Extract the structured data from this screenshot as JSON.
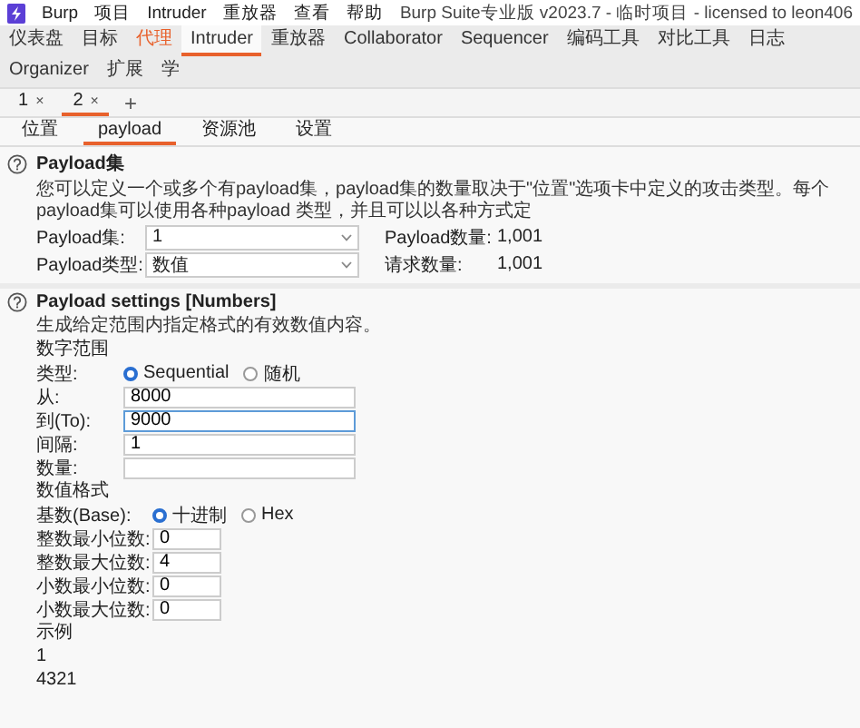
{
  "menu_bar": {
    "items": [
      "Burp",
      "项目",
      "Intruder",
      "重放器",
      "查看",
      "帮助"
    ],
    "title": "Burp Suite专业版 v2023.7 - 临时项目 - licensed to leon406"
  },
  "main_tabs": [
    {
      "label": "仪表盘",
      "selected": false,
      "highlighted": false
    },
    {
      "label": "目标",
      "selected": false,
      "highlighted": false
    },
    {
      "label": "代理",
      "selected": false,
      "highlighted": true
    },
    {
      "label": "Intruder",
      "selected": true,
      "highlighted": false
    },
    {
      "label": "重放器",
      "selected": false,
      "highlighted": false
    },
    {
      "label": "Collaborator",
      "selected": false,
      "highlighted": false
    },
    {
      "label": "Sequencer",
      "selected": false,
      "highlighted": false
    },
    {
      "label": "编码工具",
      "selected": false,
      "highlighted": false
    },
    {
      "label": "对比工具",
      "selected": false,
      "highlighted": false
    },
    {
      "label": "日志",
      "selected": false,
      "highlighted": false
    },
    {
      "label": "Organizer",
      "selected": false,
      "highlighted": false
    },
    {
      "label": "扩展",
      "selected": false,
      "highlighted": false
    },
    {
      "label": "学",
      "selected": false,
      "highlighted": false
    }
  ],
  "attack_tabs": {
    "tabs": [
      {
        "label": "1",
        "close": "×",
        "selected": false
      },
      {
        "label": "2",
        "close": "×",
        "selected": true
      }
    ],
    "add": "+"
  },
  "sub_tabs": [
    {
      "label": "位置",
      "selected": false
    },
    {
      "label": "payload",
      "selected": true
    },
    {
      "label": "资源池",
      "selected": false
    },
    {
      "label": "设置",
      "selected": false
    }
  ],
  "payload_sets": {
    "title": "Payload集",
    "description": "您可以定义一个或多个有payload集，payload集的数量取决于\"位置\"选项卡中定义的攻击类型。每个payload集可以使用各种payload 类型，并且可以以各种方式定",
    "fields": [
      {
        "label": "Payload集:",
        "value": "1"
      },
      {
        "label": "Payload类型:",
        "value": "数值"
      }
    ],
    "stats": [
      {
        "label": "Payload数量:",
        "value": "1,001"
      },
      {
        "label": "请求数量:",
        "value": "1,001"
      }
    ]
  },
  "payload_settings": {
    "title": "Payload settings [Numbers]",
    "description": "生成给定范围内指定格式的有效数值内容。",
    "range": {
      "heading": "数字范围",
      "type_label": "类型:",
      "options": [
        {
          "label": "Sequential",
          "selected": true
        },
        {
          "label": "随机",
          "selected": false
        }
      ],
      "fields": [
        {
          "label": "从:",
          "value": "8000",
          "focused": false
        },
        {
          "label": "到(To):",
          "value": "9000",
          "focused": true
        },
        {
          "label": "间隔:",
          "value": "1",
          "focused": false
        },
        {
          "label": "数量:",
          "focused": false
        }
      ]
    },
    "format": {
      "heading": "数值格式",
      "base_label": "基数(Base):",
      "options": [
        {
          "label": "十进制",
          "selected": true
        },
        {
          "label": "Hex",
          "selected": false
        }
      ],
      "fields": [
        {
          "label": "整数最小位数:",
          "value": "0"
        },
        {
          "label": "整数最大位数:",
          "value": "4"
        },
        {
          "label": "小数最小位数:",
          "value": "0"
        },
        {
          "label": "小数最大位数:",
          "value": "0"
        }
      ]
    },
    "example": {
      "heading": "示例",
      "lines": [
        "1",
        "4321"
      ]
    }
  }
}
